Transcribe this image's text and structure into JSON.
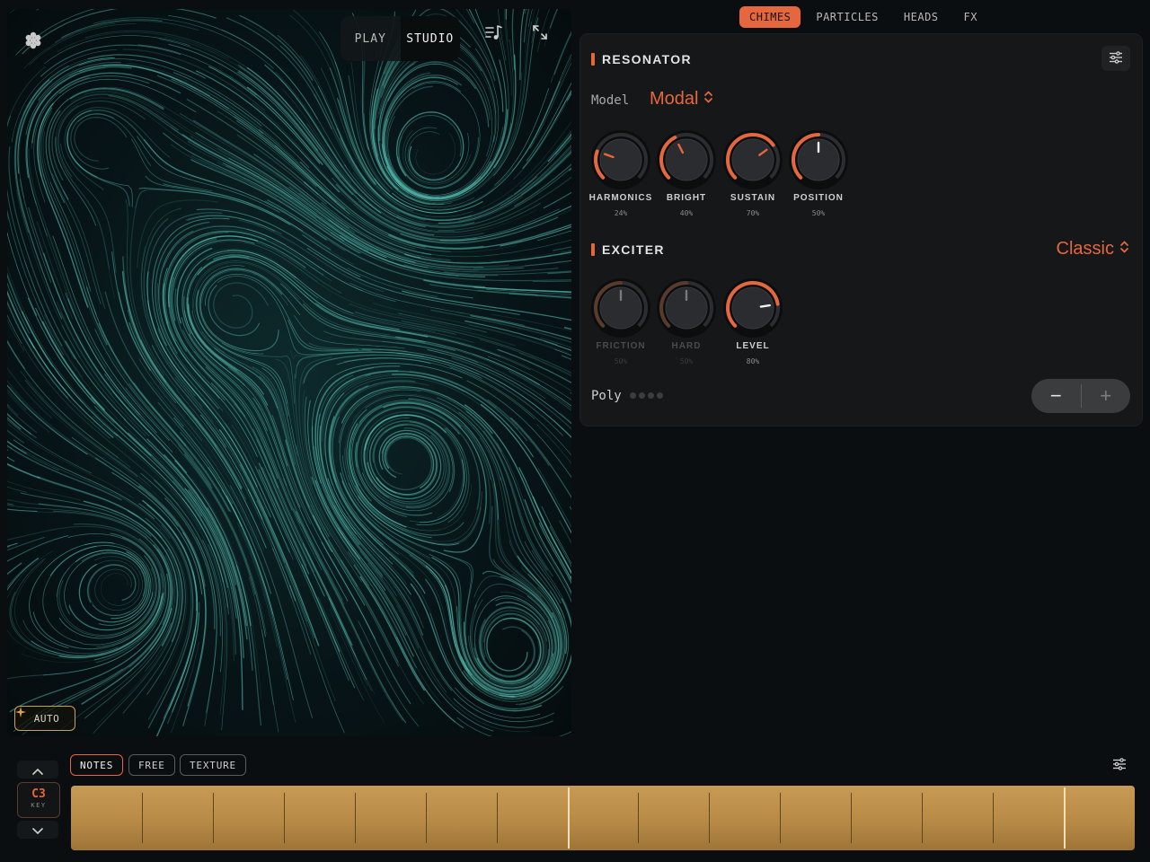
{
  "canvas": {
    "mode_switch": {
      "play_label": "PLAY",
      "studio_label": "STUDIO",
      "active": "STUDIO"
    },
    "icons": [
      "flower-icon",
      "music-note-list-icon",
      "expand-icon",
      "sparkle-icon"
    ],
    "auto_label": "AUTO",
    "trail_color": "#5fd2c4"
  },
  "top_tabs": [
    {
      "label": "CHIMES",
      "active": true
    },
    {
      "label": "PARTICLES",
      "active": false
    },
    {
      "label": "HEADS",
      "active": false
    },
    {
      "label": "FX",
      "active": false
    }
  ],
  "resonator": {
    "title": "RESONATOR",
    "model_label": "Model",
    "model_value": "Modal",
    "knobs": [
      {
        "label": "HARMONICS",
        "value": "24%",
        "level": 0.24,
        "active": true
      },
      {
        "label": "BRIGHT",
        "value": "40%",
        "level": 0.4,
        "active": true
      },
      {
        "label": "SUSTAIN",
        "value": "70%",
        "level": 0.7,
        "active": true
      },
      {
        "label": "POSITION",
        "value": "50%",
        "level": 0.5,
        "active": true
      }
    ]
  },
  "exciter": {
    "title": "EXCITER",
    "type_value": "Classic",
    "knobs": [
      {
        "label": "FRICTION",
        "value": "50%",
        "level": 0.5,
        "active": false
      },
      {
        "label": "HARD",
        "value": "50%",
        "level": 0.5,
        "active": false
      },
      {
        "label": "LEVEL",
        "value": "80%",
        "level": 0.8,
        "active": true
      }
    ]
  },
  "poly": {
    "label": "Poly",
    "dots": 4,
    "minus": "−",
    "plus": "+"
  },
  "play_modes": [
    {
      "label": "NOTES",
      "active": true
    },
    {
      "label": "FREE",
      "active": false
    },
    {
      "label": "TEXTURE",
      "active": false
    }
  ],
  "key": {
    "note": "C3",
    "label": "KEY"
  },
  "keyboard": {
    "keys": 15,
    "octave_markers": [
      7,
      14
    ]
  },
  "colors": {
    "accent": "#e5673e",
    "keyboard": "#b88b47",
    "background": "#0b0e10",
    "panel": "#161718"
  }
}
